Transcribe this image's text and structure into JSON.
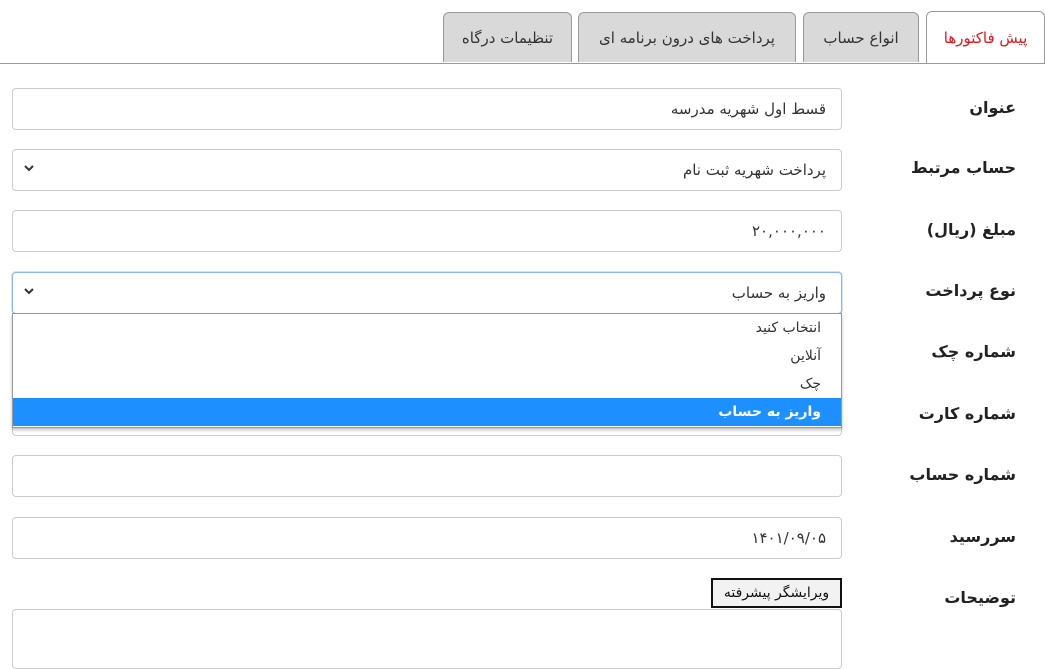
{
  "tabs": [
    {
      "label": "پیش فاکتورها",
      "active": true
    },
    {
      "label": "انواع حساب",
      "active": false
    },
    {
      "label": "پرداخت های درون برنامه ای",
      "active": false
    },
    {
      "label": "تنظیمات درگاه",
      "active": false
    }
  ],
  "form": {
    "title": {
      "label": "عنوان",
      "value": "قسط اول شهریه مدرسه"
    },
    "account": {
      "label": "حساب مرتبط",
      "value": "پرداخت شهریه ثبت نام"
    },
    "amount": {
      "label": "مبلغ (ریال)",
      "value": "۲۰,۰۰۰,۰۰۰"
    },
    "payment_type": {
      "label": "نوع پرداخت",
      "value": "واریز به حساب",
      "options": [
        "انتخاب کنید",
        "آنلاین",
        "چک",
        "واریز به حساب"
      ],
      "selected_index": 3
    },
    "check_number": {
      "label": "شماره چک",
      "value": ""
    },
    "card_number": {
      "label": "شماره کارت",
      "value": ""
    },
    "account_number": {
      "label": "شماره حساب",
      "value": ""
    },
    "due_date": {
      "label": "سررسید",
      "value": "۱۴۰۱/۰۹/۰۵"
    },
    "description": {
      "label": "توضیحات",
      "editor_button": "ویرایشگر پیشرفته",
      "value": ""
    }
  },
  "colors": {
    "active_tab_text": "#e3141c",
    "selected_option": "#1e8fff",
    "tab_bg": "#d9d9d9"
  },
  "icons": {
    "select_arrow": "chevron-down-icon"
  }
}
